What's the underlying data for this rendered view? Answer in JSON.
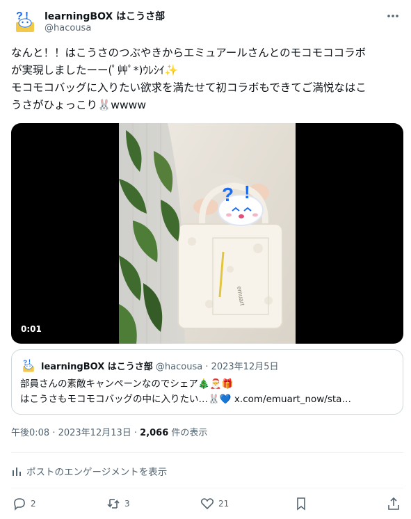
{
  "author": {
    "name": "learningBOX はこうさ部",
    "handle": "@hacousa",
    "avatar_icon": "rabbit-mascot-icon"
  },
  "tweet": {
    "text": "なんと！！はこうさのつぶやきからエミュアールさんとのモコモココラボ\nが実現しましたーー(ﾟ艸ﾟ*)ｳﾚｼｲ✨\nモコモコバッグに入りたい欲求を満たせて初コラボもできてご満悦なはこ\nうさがひょっこり🐰wwww"
  },
  "video": {
    "timestamp": "0:01",
    "bag_text": "emuart"
  },
  "quote": {
    "name": "learningBOX はこうさ部",
    "meta": " @hacousa · 2023年12月5日",
    "text": "部員さんの素敵キャンペーンなのでシェア🎄🎅🎁\nはこうさもモコモコバッグの中に入りたい…🐰💙 x.com/emuart_now/sta…"
  },
  "meta": {
    "time": "午後0:08 · 2023年12月13日 · ",
    "views": "2,066",
    "views_suffix": " 件の表示"
  },
  "engagement_label": "ポストのエンゲージメントを表示",
  "actions": {
    "replies": "2",
    "reposts": "3",
    "likes": "21"
  },
  "colors": {
    "text": "#0f1419",
    "secondary": "#536471",
    "border": "#cfd9de",
    "mascot_blue": "#1d6cf0"
  }
}
